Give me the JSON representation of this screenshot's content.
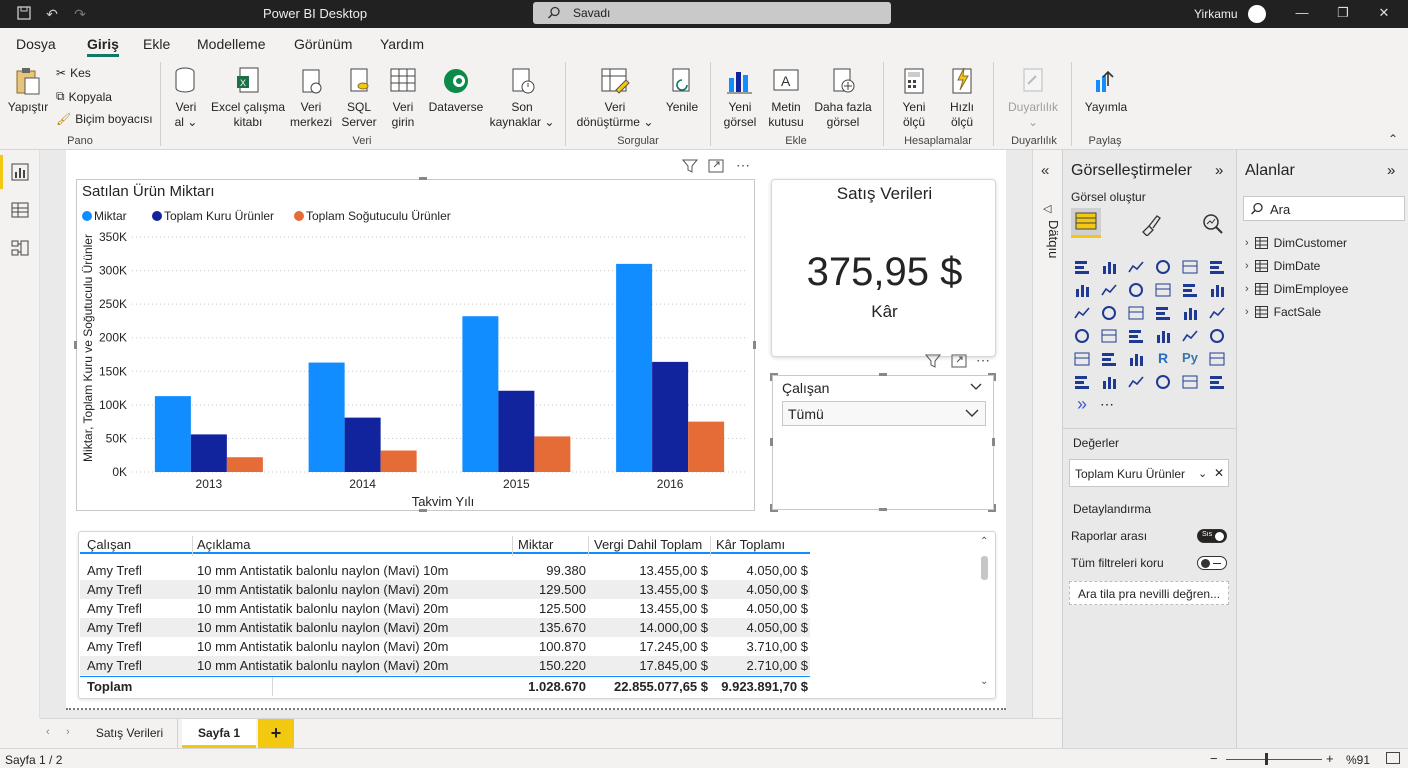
{
  "app": {
    "title": "Power BI Desktop",
    "search_placeholder": "Savadı",
    "user": "Yirkamu"
  },
  "menu": [
    "Dosya",
    "Giriş",
    "Ekle",
    "Modelleme",
    "Görünüm",
    "Yardım"
  ],
  "ribbon": {
    "clipboard": {
      "paste": "Yapıştır",
      "cut": "Kes",
      "copy": "Kopyala",
      "format_painter": "Biçim boyacısı",
      "group": "Pano"
    },
    "data": {
      "get_data_1": "Veri",
      "get_data_2": "al",
      "excel_1": "Excel çalışma",
      "excel_2": "kitabı",
      "hub_1": "Veri",
      "hub_2": "merkezi",
      "sql_1": "SQL",
      "sql_2": "Server",
      "enter_1": "Veri",
      "enter_2": "girin",
      "dataverse": "Dataverse",
      "recent_1": "Son",
      "recent_2": "kaynaklar",
      "group": "Veri"
    },
    "queries": {
      "transform_1": "Veri",
      "transform_2": "dönüştürme",
      "refresh": "Yenile",
      "group": "Sorgular"
    },
    "insert": {
      "new_visual_1": "Yeni",
      "new_visual_2": "görsel",
      "textbox_1": "Metin",
      "textbox_2": "kutusu",
      "more_1": "Daha fazla",
      "more_2": "görsel",
      "group": "Ekle"
    },
    "calc": {
      "new_measure_1": "Yeni",
      "new_measure_2": "ölçü",
      "quick_1": "Hızlı",
      "quick_2": "ölçü",
      "group": "Hesaplamalar"
    },
    "sensitivity": {
      "label": "Duyarlılık",
      "group": "Duyarlılık"
    },
    "share": {
      "publish": "Yayımla",
      "group": "Paylaş"
    }
  },
  "chart_data": {
    "type": "bar",
    "title": "Satılan Ürün Miktarı",
    "xlabel": "Takvim Yılı",
    "ylabel": "Miktar, Toplam Kuru ve Soğutuculu Ürünler",
    "categories": [
      "2013",
      "2014",
      "2015",
      "2016"
    ],
    "ylim": [
      0,
      350000
    ],
    "yticks": [
      "0K",
      "50K",
      "100K",
      "150K",
      "200K",
      "250K",
      "300K",
      "350K"
    ],
    "yticks_values": [
      0,
      50000,
      100000,
      150000,
      200000,
      250000,
      300000,
      350000
    ],
    "legend_position": "top-left",
    "series": [
      {
        "name": "Miktar",
        "color": "#118dff",
        "values": [
          113000,
          163000,
          232000,
          310000
        ]
      },
      {
        "name": "Toplam Kuru Ürünler",
        "color": "#12239e",
        "values": [
          56000,
          81000,
          121000,
          164000
        ]
      },
      {
        "name": "Toplam Soğutuculu Ürünler",
        "color": "#e66c37",
        "values": [
          22000,
          32000,
          53000,
          75000
        ]
      }
    ]
  },
  "card": {
    "title": "Satış Verileri",
    "value": "375,95 $",
    "label": "Kâr"
  },
  "slicer": {
    "title": "Çalışan",
    "selected": "Tümü"
  },
  "table": {
    "headers": [
      "Çalışan",
      "Açıklama",
      "Miktar",
      "Vergi Dahil Toplam",
      "Kâr Toplamı"
    ],
    "rows": [
      [
        "Amy Trefl",
        "10 mm Antistatik balonlu naylon (Mavi) 10m",
        "99.380",
        "13.455,00 $",
        "4.050,00 $"
      ],
      [
        "Amy Trefl",
        "10 mm Antistatik balonlu naylon (Mavi) 20m",
        "129.500",
        "13.455,00 $",
        "4.050,00 $"
      ],
      [
        "Amy Trefl",
        "10 mm Antistatik balonlu naylon (Mavi) 20m",
        "125.500",
        "13.455,00 $",
        "4.050,00 $"
      ],
      [
        "Amy Trefl",
        "10 mm Antistatik balonlu naylon (Mavi) 20m",
        "135.670",
        "14.000,00 $",
        "4.050,00 $"
      ],
      [
        "Amy Trefl",
        "10 mm Antistatik balonlu naylon (Mavi) 20m",
        "100.870",
        "17.245,00 $",
        "3.710,00 $"
      ],
      [
        "Amy Trefl",
        "10 mm Antistatik balonlu naylon (Mavi) 20m",
        "150.220",
        "17.845,00 $",
        "2.710,00 $"
      ]
    ],
    "total": [
      "Toplam",
      "",
      "1.028.670",
      "22.855.077,65 $",
      "9.923.891,70 $"
    ]
  },
  "filters": {
    "label": "Dätqıu"
  },
  "viz": {
    "title": "Görselleştirmeler",
    "build": "Görsel oluştur",
    "values": "Değerler",
    "values_field": "Toplam Kuru Ürünler",
    "drillthrough": "Detaylandırma",
    "cross_report": "Raporlar arası",
    "cross_report_state": "Sıs",
    "keep_filters": "Tüm filtreleri koru",
    "drop_placeholder": "Ara tila pra nevilli değren..."
  },
  "fields": {
    "title": "Alanlar",
    "search": "Ara",
    "tables": [
      "DimCustomer",
      "DimDate",
      "DimEmployee",
      "FactSale"
    ]
  },
  "pages": {
    "tabs": [
      "Satış Verileri",
      "Sayfa 1"
    ],
    "add": "+"
  },
  "status": {
    "page": "Sayfa 1 / 2",
    "zoom": "%91"
  }
}
